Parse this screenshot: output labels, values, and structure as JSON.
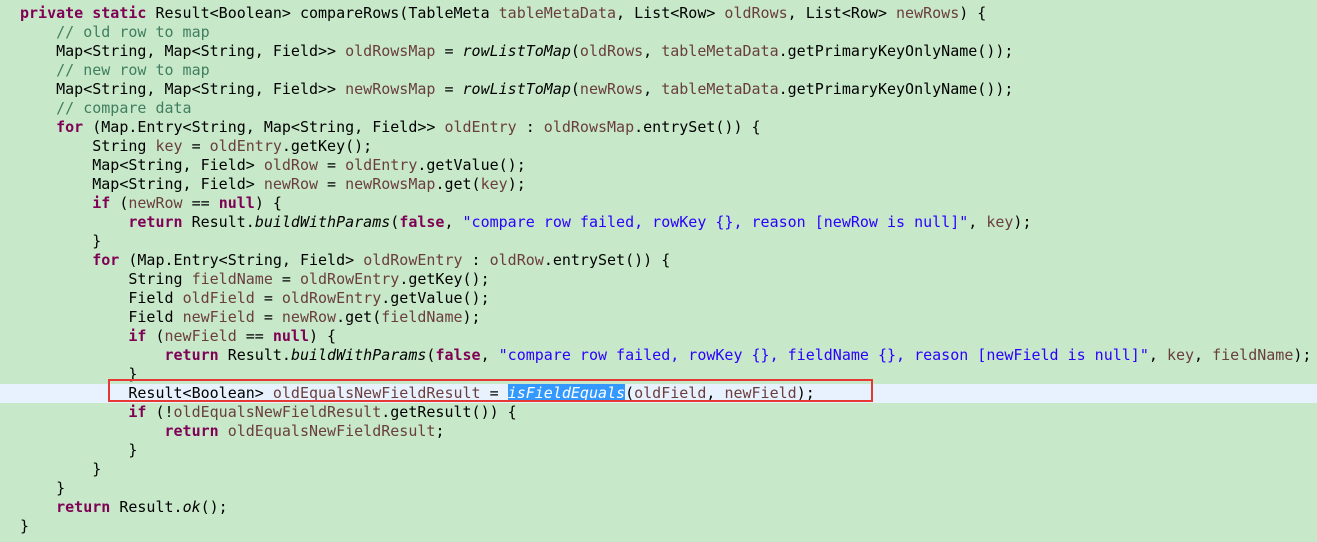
{
  "editor": {
    "lines": [
      [
        {
          "t": "private static ",
          "c": "kw"
        },
        {
          "t": "Result<Boolean> compareRows(TableMeta "
        },
        {
          "t": "tableMetaData",
          "c": "var"
        },
        {
          "t": ", List<Row> "
        },
        {
          "t": "oldRows",
          "c": "var"
        },
        {
          "t": ", List<Row> "
        },
        {
          "t": "newRows",
          "c": "var"
        },
        {
          "t": ") {"
        }
      ],
      [
        {
          "t": "    "
        },
        {
          "t": "// old row to map",
          "c": "cm"
        }
      ],
      [
        {
          "t": "    Map<String, Map<String, Field>> "
        },
        {
          "t": "oldRowsMap",
          "c": "var"
        },
        {
          "t": " = "
        },
        {
          "t": "rowListToMap",
          "c": "it"
        },
        {
          "t": "("
        },
        {
          "t": "oldRows",
          "c": "var"
        },
        {
          "t": ", "
        },
        {
          "t": "tableMetaData",
          "c": "var"
        },
        {
          "t": ".getPrimaryKeyOnlyName());"
        }
      ],
      [
        {
          "t": "    "
        },
        {
          "t": "// new row to map",
          "c": "cm"
        }
      ],
      [
        {
          "t": "    Map<String, Map<String, Field>> "
        },
        {
          "t": "newRowsMap",
          "c": "var"
        },
        {
          "t": " = "
        },
        {
          "t": "rowListToMap",
          "c": "it"
        },
        {
          "t": "("
        },
        {
          "t": "newRows",
          "c": "var"
        },
        {
          "t": ", "
        },
        {
          "t": "tableMetaData",
          "c": "var"
        },
        {
          "t": ".getPrimaryKeyOnlyName());"
        }
      ],
      [
        {
          "t": "    "
        },
        {
          "t": "// compare data",
          "c": "cm"
        }
      ],
      [
        {
          "t": "    "
        },
        {
          "t": "for",
          "c": "kw"
        },
        {
          "t": " (Map.Entry<String, Map<String, Field>> "
        },
        {
          "t": "oldEntry",
          "c": "var"
        },
        {
          "t": " : "
        },
        {
          "t": "oldRowsMap",
          "c": "var"
        },
        {
          "t": ".entrySet()) {"
        }
      ],
      [
        {
          "t": "        String "
        },
        {
          "t": "key",
          "c": "var"
        },
        {
          "t": " = "
        },
        {
          "t": "oldEntry",
          "c": "var"
        },
        {
          "t": ".getKey();"
        }
      ],
      [
        {
          "t": "        Map<String, Field> "
        },
        {
          "t": "oldRow",
          "c": "var"
        },
        {
          "t": " = "
        },
        {
          "t": "oldEntry",
          "c": "var"
        },
        {
          "t": ".getValue();"
        }
      ],
      [
        {
          "t": "        Map<String, Field> "
        },
        {
          "t": "newRow",
          "c": "var"
        },
        {
          "t": " = "
        },
        {
          "t": "newRowsMap",
          "c": "var"
        },
        {
          "t": ".get("
        },
        {
          "t": "key",
          "c": "var"
        },
        {
          "t": ");"
        }
      ],
      [
        {
          "t": "        "
        },
        {
          "t": "if",
          "c": "kw"
        },
        {
          "t": " ("
        },
        {
          "t": "newRow",
          "c": "var"
        },
        {
          "t": " == "
        },
        {
          "t": "null",
          "c": "kw"
        },
        {
          "t": ") {"
        }
      ],
      [
        {
          "t": "            "
        },
        {
          "t": "return",
          "c": "kw"
        },
        {
          "t": " Result."
        },
        {
          "t": "buildWithParams",
          "c": "it"
        },
        {
          "t": "("
        },
        {
          "t": "false",
          "c": "kw"
        },
        {
          "t": ", "
        },
        {
          "t": "\"compare row failed, rowKey {}, reason [newRow is null]\"",
          "c": "str"
        },
        {
          "t": ", "
        },
        {
          "t": "key",
          "c": "var"
        },
        {
          "t": ");"
        }
      ],
      [
        {
          "t": "        }"
        }
      ],
      [
        {
          "t": "        "
        },
        {
          "t": "for",
          "c": "kw"
        },
        {
          "t": " (Map.Entry<String, Field> "
        },
        {
          "t": "oldRowEntry",
          "c": "var"
        },
        {
          "t": " : "
        },
        {
          "t": "oldRow",
          "c": "var"
        },
        {
          "t": ".entrySet()) {"
        }
      ],
      [
        {
          "t": "            String "
        },
        {
          "t": "fieldName",
          "c": "var"
        },
        {
          "t": " = "
        },
        {
          "t": "oldRowEntry",
          "c": "var"
        },
        {
          "t": ".getKey();"
        }
      ],
      [
        {
          "t": "            Field "
        },
        {
          "t": "oldField",
          "c": "var"
        },
        {
          "t": " = "
        },
        {
          "t": "oldRowEntry",
          "c": "var"
        },
        {
          "t": ".getValue();"
        }
      ],
      [
        {
          "t": "            Field "
        },
        {
          "t": "newField",
          "c": "var"
        },
        {
          "t": " = "
        },
        {
          "t": "newRow",
          "c": "var"
        },
        {
          "t": ".get("
        },
        {
          "t": "fieldName",
          "c": "var"
        },
        {
          "t": ");"
        }
      ],
      [
        {
          "t": "            "
        },
        {
          "t": "if",
          "c": "kw"
        },
        {
          "t": " ("
        },
        {
          "t": "newField",
          "c": "var"
        },
        {
          "t": " == "
        },
        {
          "t": "null",
          "c": "kw"
        },
        {
          "t": ") {"
        }
      ],
      [
        {
          "t": "                "
        },
        {
          "t": "return",
          "c": "kw"
        },
        {
          "t": " Result."
        },
        {
          "t": "buildWithParams",
          "c": "it"
        },
        {
          "t": "("
        },
        {
          "t": "false",
          "c": "kw"
        },
        {
          "t": ", "
        },
        {
          "t": "\"compare row failed, rowKey {}, fieldName {}, reason [newField is null]\"",
          "c": "str"
        },
        {
          "t": ", "
        },
        {
          "t": "key",
          "c": "var"
        },
        {
          "t": ", "
        },
        {
          "t": "fieldName",
          "c": "var"
        },
        {
          "t": ");"
        }
      ],
      [
        {
          "t": "            }"
        }
      ],
      [
        {
          "t": "            Result<Boolean> "
        },
        {
          "t": "oldEqualsNewFieldResult",
          "c": "var"
        },
        {
          "t": " = "
        },
        {
          "t": "isFieldEquals",
          "c": "sel"
        },
        {
          "t": "("
        },
        {
          "t": "oldField",
          "c": "var"
        },
        {
          "t": ", "
        },
        {
          "t": "newField",
          "c": "var"
        },
        {
          "t": ");"
        }
      ],
      [
        {
          "t": "            "
        },
        {
          "t": "if",
          "c": "kw"
        },
        {
          "t": " (!"
        },
        {
          "t": "oldEqualsNewFieldResult",
          "c": "var"
        },
        {
          "t": ".getResult()) {"
        }
      ],
      [
        {
          "t": "                "
        },
        {
          "t": "return",
          "c": "kw"
        },
        {
          "t": " "
        },
        {
          "t": "oldEqualsNewFieldResult",
          "c": "var"
        },
        {
          "t": ";"
        }
      ],
      [
        {
          "t": "            }"
        }
      ],
      [
        {
          "t": "        }"
        }
      ],
      [
        {
          "t": "    }"
        }
      ],
      [
        {
          "t": "    "
        },
        {
          "t": "return",
          "c": "kw"
        },
        {
          "t": " Result."
        },
        {
          "t": "ok",
          "c": "it"
        },
        {
          "t": "();"
        }
      ],
      [
        {
          "t": "}"
        }
      ]
    ],
    "current_line": 20,
    "highlight_line": 20
  },
  "colors": {
    "background": "#c7e8c9",
    "keyword": "#7f0055",
    "comment": "#3f7f5f",
    "string": "#2a00ff",
    "variable": "#6a3e3e",
    "selection": "#3399ff",
    "current_line": "#e8f2fe",
    "highlight_box": "#e53935"
  }
}
